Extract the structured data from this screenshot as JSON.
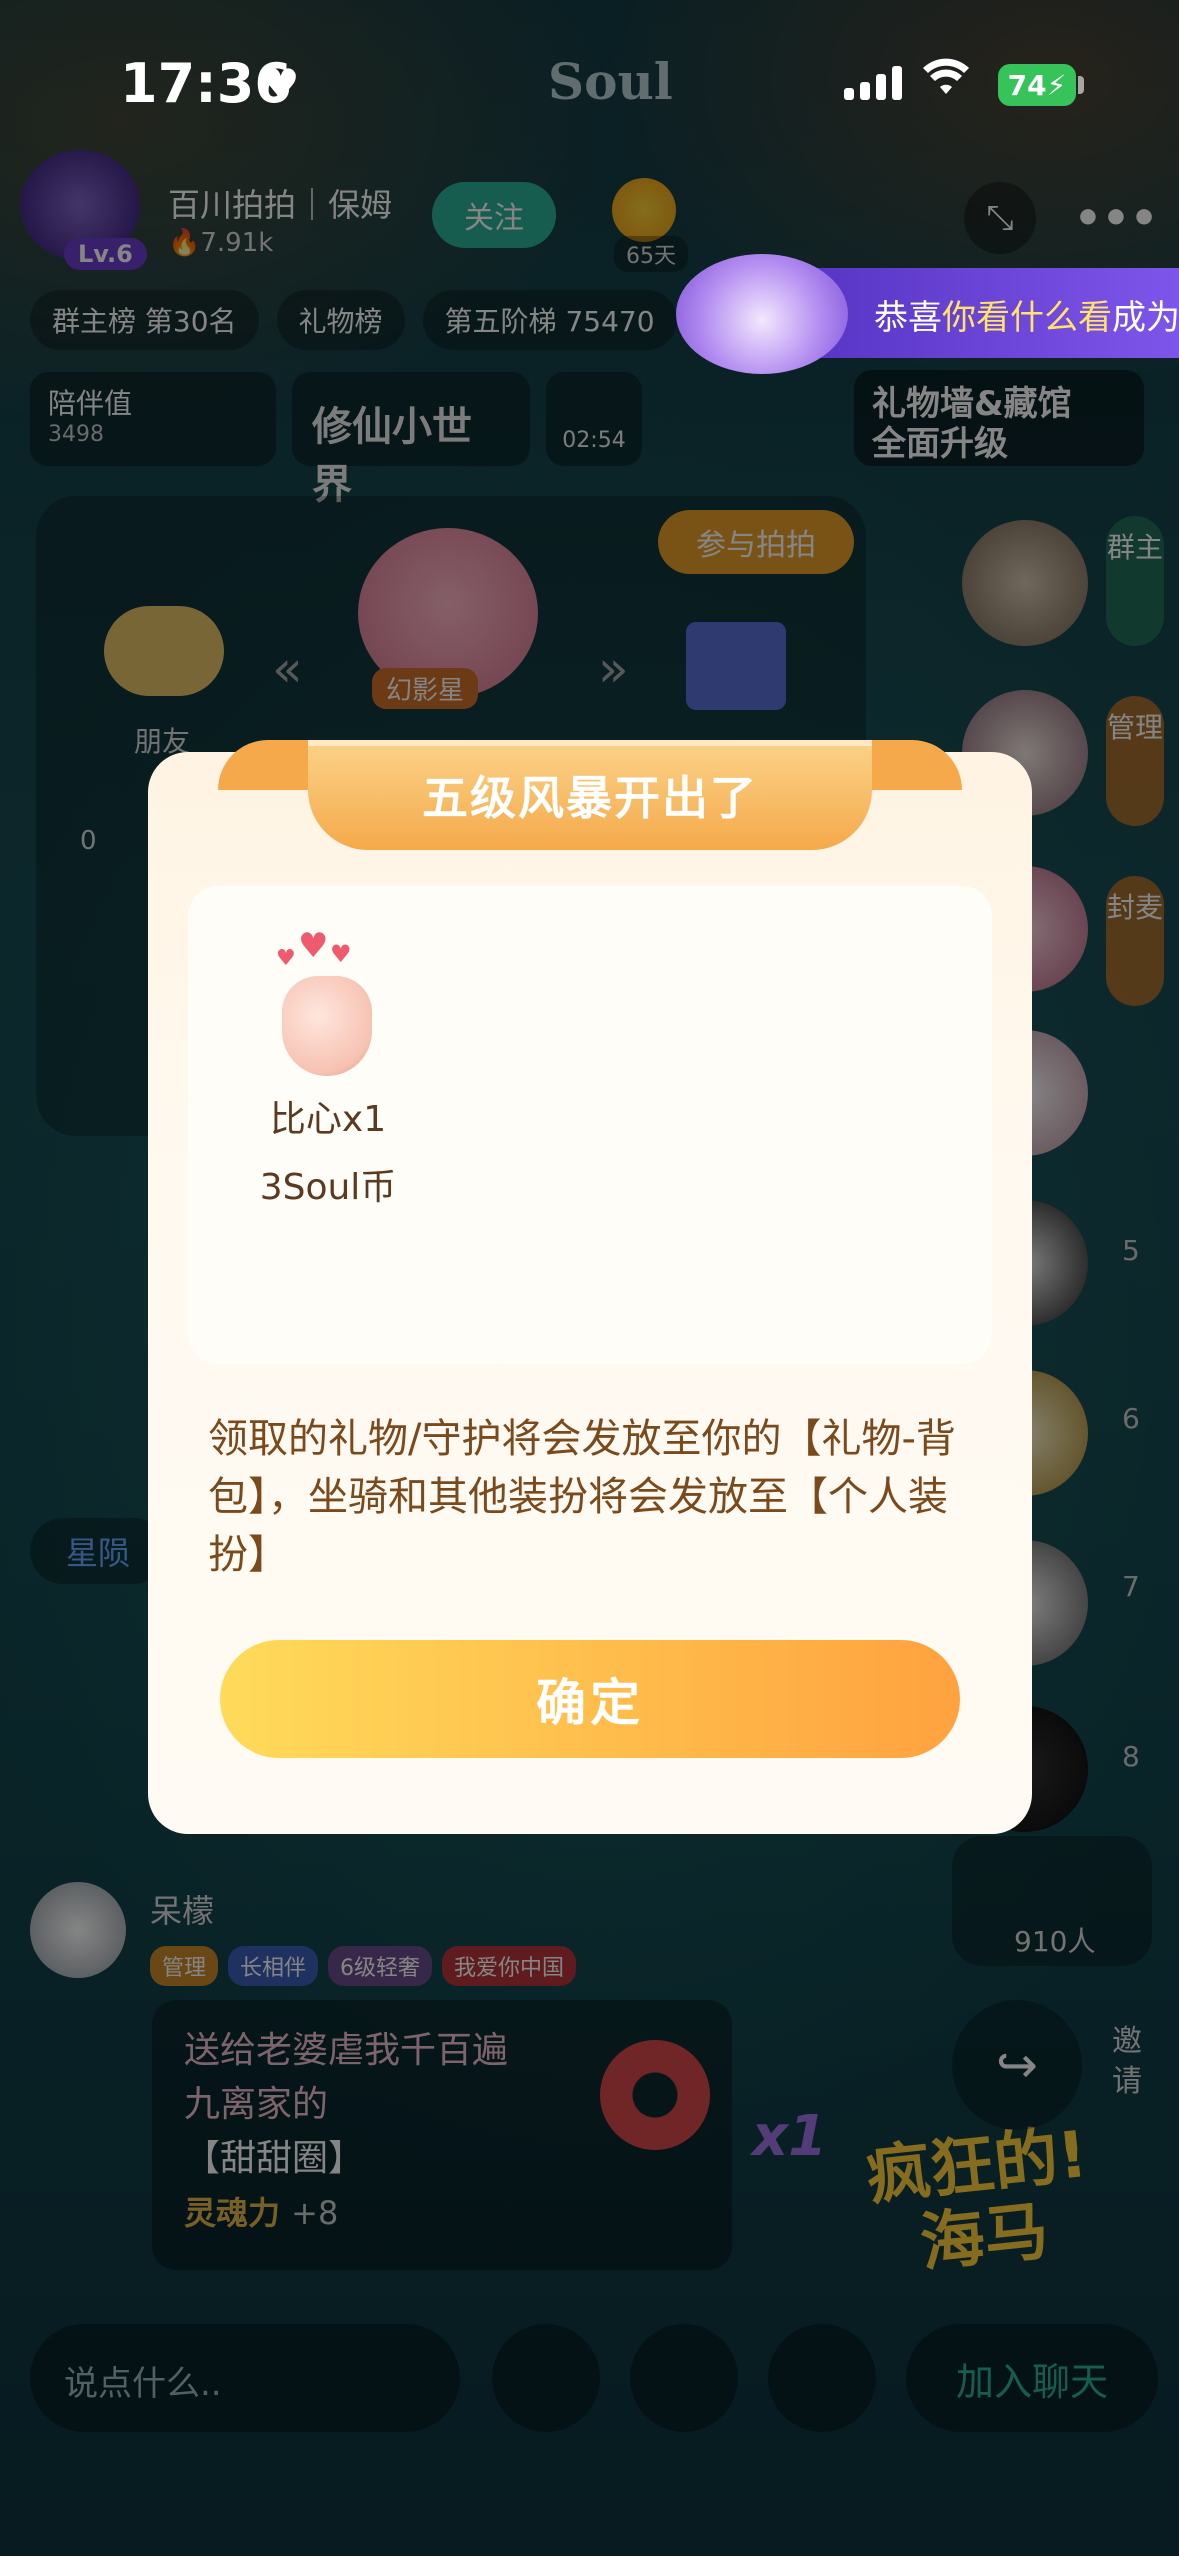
{
  "status_bar": {
    "time": "17:36",
    "app_name": "Soul",
    "battery": "74"
  },
  "room": {
    "title": "百川拍拍｜保姆",
    "level": "Lv.6",
    "heat": "7.91k",
    "follow_label": "关注",
    "sun_count": "65天",
    "chips": [
      "群主榜 第30名",
      "礼物榜",
      "第五阶梯 75470"
    ],
    "companion_label": "陪伴值",
    "companion_value": "3498",
    "panel_title": "修仙小世界",
    "timer": "02:54",
    "gift_wall": [
      "礼物墙&藏馆",
      "全面升级"
    ],
    "join_pat": "参与拍拍",
    "friend_label": "朋友",
    "bear_tag": "幻影星",
    "zero": "0"
  },
  "toast": {
    "prefix": "恭喜",
    "highlight": "你看什么看",
    "suffix": "成为"
  },
  "seats": {
    "side_labels": [
      "群主",
      "管理",
      "封麦"
    ],
    "numbers": [
      "5",
      "6",
      "7",
      "8"
    ]
  },
  "chat": {
    "user_name": "呆檬",
    "badges": [
      "管理",
      "长相伴",
      "6级轻奢",
      "我爱你中国"
    ],
    "gift_lines": [
      "送给老婆虐我千百遍",
      "九离家的",
      "【甜甜圈】"
    ],
    "soul_power": "灵魂力",
    "soul_power_value": "+8",
    "gift_count": "x1",
    "event_logo": [
      "疯狂的!",
      "海马"
    ],
    "online_count": "910人",
    "invite": "邀请",
    "side_tag": "星陨"
  },
  "bottom_bar": {
    "input_placeholder": "说点什么..",
    "join_chat": "加入聊天"
  },
  "modal": {
    "title": "五级风暴开出了",
    "prize": {
      "name": "比心x1",
      "value": "3Soul币"
    },
    "note": "领取的礼物/守护将会发放至你的【礼物-背包】，坐骑和其他装扮将会发放至【个人装扮】",
    "confirm": "确定"
  }
}
